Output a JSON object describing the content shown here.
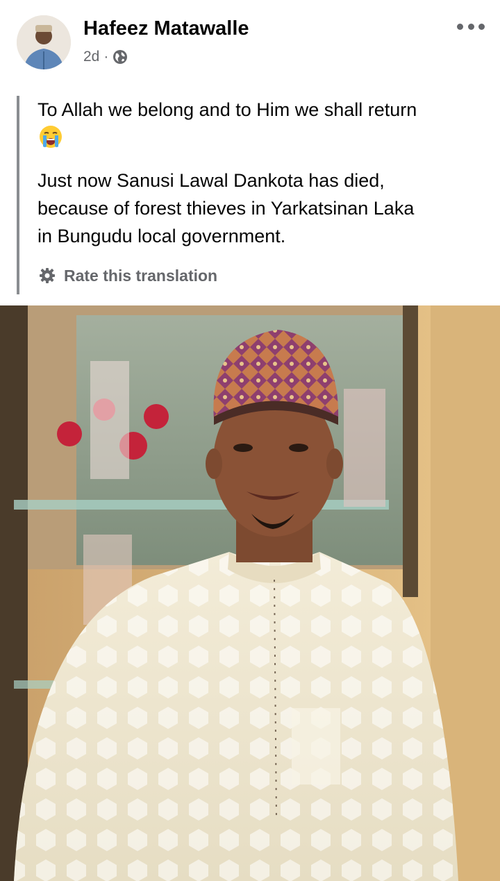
{
  "post": {
    "author": "Hafeez Matawalle",
    "time": "2d",
    "separator": "·",
    "audience_icon": "globe-icon",
    "more_icon": "more-horizontal-icon",
    "translation": {
      "line1": "To Allah we belong and to Him we shall return",
      "emoji": "loudly-crying-face",
      "line2": "Just now Sanusi Lawal Dankota has died,",
      "line3": "because of forest thieves in Yarkatsinan Laka",
      "line4": "in Bungudu local government.",
      "rate_label": "Rate this translation",
      "rate_icon": "gear-icon"
    },
    "photo": {
      "subject": "man-in-cap-photo"
    }
  },
  "colors": {
    "text": "#050505",
    "secondary": "#65676b",
    "quote_bar": "#8a8d91"
  }
}
